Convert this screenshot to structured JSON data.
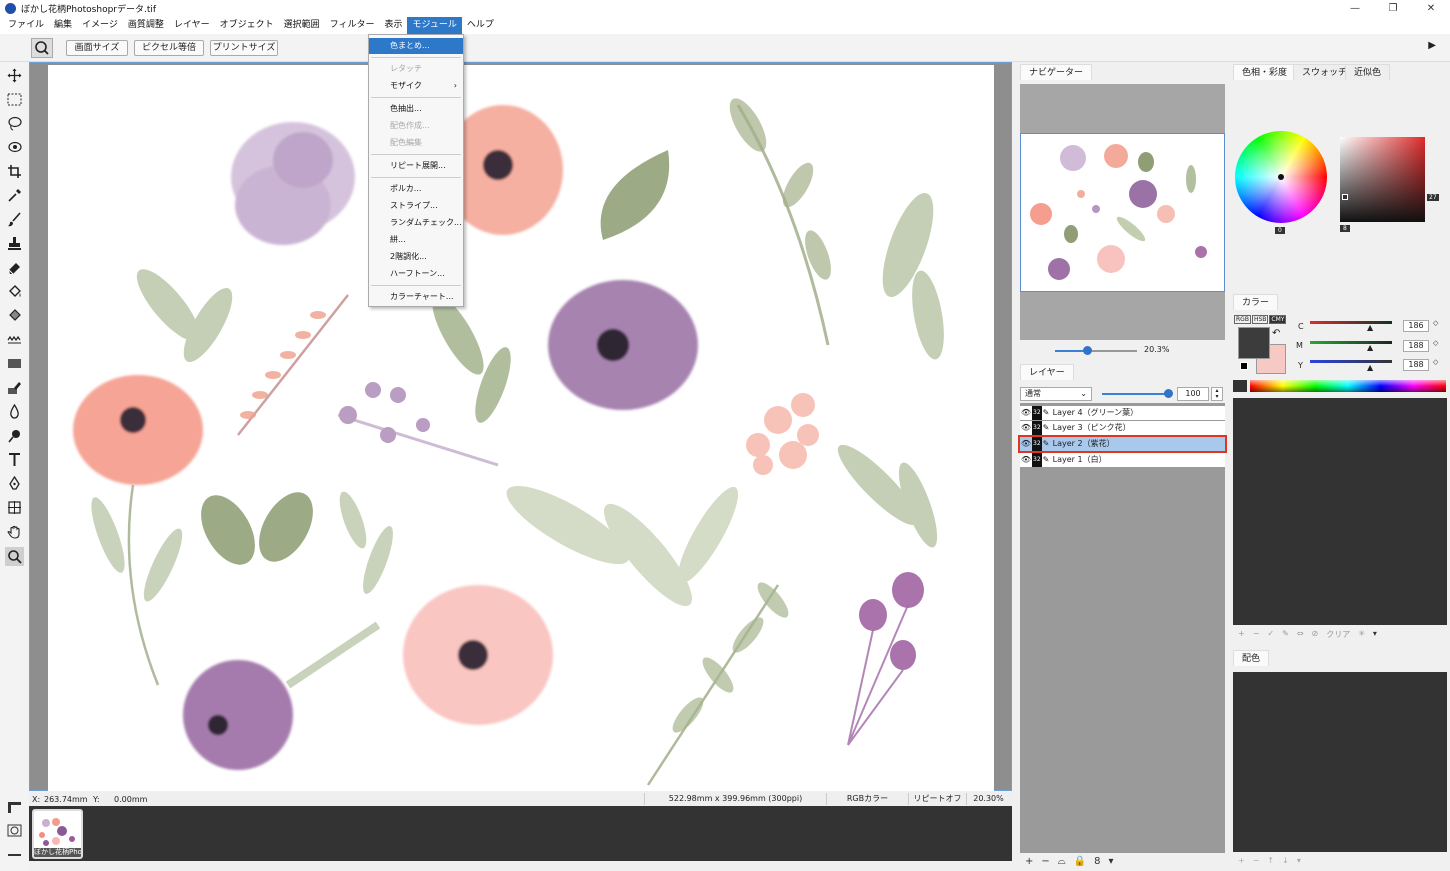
{
  "window": {
    "title": "ぼかし花柄Photoshoprデータ.tif",
    "min": "—",
    "max": "❐",
    "close": "✕"
  },
  "menubar": [
    "ファイル",
    "編集",
    "イメージ",
    "画質調整",
    "レイヤー",
    "オブジェクト",
    "選択範囲",
    "フィルター",
    "表示",
    "モジュール",
    "ヘルプ"
  ],
  "options_bar": {
    "screen_size": "画面サイズ",
    "pixel_equal": "ピクセル等倍",
    "print_size": "プリントサイズ"
  },
  "module_menu": {
    "items": [
      {
        "label": "色まとめ...",
        "state": "highlighted"
      },
      {
        "label": "レタッチ",
        "state": "disabled"
      },
      {
        "label": "モザイク",
        "state": "normal",
        "submenu": true
      },
      {
        "label": "色抽出...",
        "state": "normal"
      },
      {
        "label": "配色作成...",
        "state": "disabled"
      },
      {
        "label": "配色編集",
        "state": "disabled"
      },
      {
        "label": "リピート展開...",
        "state": "normal"
      },
      {
        "label": "ポルカ...",
        "state": "normal"
      },
      {
        "label": "ストライプ...",
        "state": "normal"
      },
      {
        "label": "ランダムチェック...",
        "state": "normal"
      },
      {
        "label": "絣...",
        "state": "normal"
      },
      {
        "label": "2階調化...",
        "state": "normal"
      },
      {
        "label": "ハーフトーン...",
        "state": "normal"
      },
      {
        "label": "カラーチャート...",
        "state": "normal"
      }
    ]
  },
  "status": {
    "x_label": "X:",
    "x_value": "263.74mm",
    "y_label": "Y:",
    "y_value": "0.00mm",
    "doc_size": "522.98mm x 399.96mm (300ppi)",
    "color_mode": "RGBカラー",
    "repeat": "リピートオフ",
    "zoom": "20.30%"
  },
  "thumbnail": {
    "label": "ぼかし花柄Pho"
  },
  "navigator": {
    "title": "ナビゲーター",
    "zoom": "20.3%",
    "zoom_fraction": 0.4
  },
  "layers": {
    "title": "レイヤー",
    "blend_mode": "通常",
    "opacity": "100",
    "items": [
      {
        "name": "Layer 4（グリーン葉）",
        "badge": "32",
        "selected": false
      },
      {
        "name": "Layer 3（ピンク花）",
        "badge": "32",
        "selected": false
      },
      {
        "name": "Layer 2（紫花）",
        "badge": "32",
        "selected": true
      },
      {
        "name": "Layer 1（白）",
        "badge": "32",
        "selected": false
      }
    ]
  },
  "color_tabs": [
    "色相・彩度",
    "スウォッチ",
    "近似色"
  ],
  "color_picker": {
    "hue_value": "0",
    "sat_value": "8",
    "bright_value": "27"
  },
  "color_panel": {
    "title": "カラー",
    "modes": [
      "RGB",
      "HSB",
      "CMY"
    ],
    "channels": [
      {
        "label": "C",
        "value": "186"
      },
      {
        "label": "M",
        "value": "188"
      },
      {
        "label": "Y",
        "value": "188"
      }
    ],
    "fg_color": "#3c3c3c",
    "bg_color": "#f7c9c5"
  },
  "swatch_footer": {
    "clear": "クリア"
  },
  "scheme": {
    "title": "配色"
  }
}
